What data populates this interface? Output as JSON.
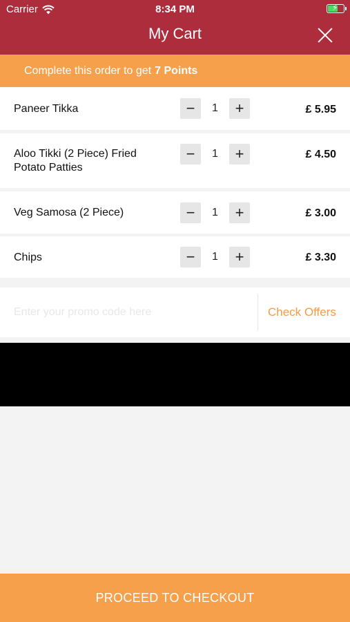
{
  "status_bar": {
    "carrier": "Carrier",
    "time": "8:34 PM",
    "battery_level": 0.6
  },
  "header": {
    "title": "My Cart",
    "close_icon": "close-icon"
  },
  "banner": {
    "prefix": "Complete this order to get",
    "points": "7 Points"
  },
  "cart": {
    "items": [
      {
        "name": "Paneer Tikka",
        "quantity": "1",
        "price": "£ 5.95"
      },
      {
        "name": "Aloo Tikki (2 Piece) Fried Potato Patties",
        "quantity": "1",
        "price": "£ 4.50"
      },
      {
        "name": "Veg Samosa (2 Piece)",
        "quantity": "1",
        "price": "£ 3.00"
      },
      {
        "name": "Chips",
        "quantity": "1",
        "price": "£ 3.30"
      }
    ],
    "minus_symbol": "−",
    "plus_symbol": "+"
  },
  "promo": {
    "placeholder": "Enter your promo code here",
    "value": "",
    "button": "Check Offers"
  },
  "checkout": {
    "label": "PROCEED TO CHECKOUT"
  },
  "colors": {
    "header": "#ad2d3c",
    "accent": "#f7a04c",
    "battery": "#4cd964"
  }
}
